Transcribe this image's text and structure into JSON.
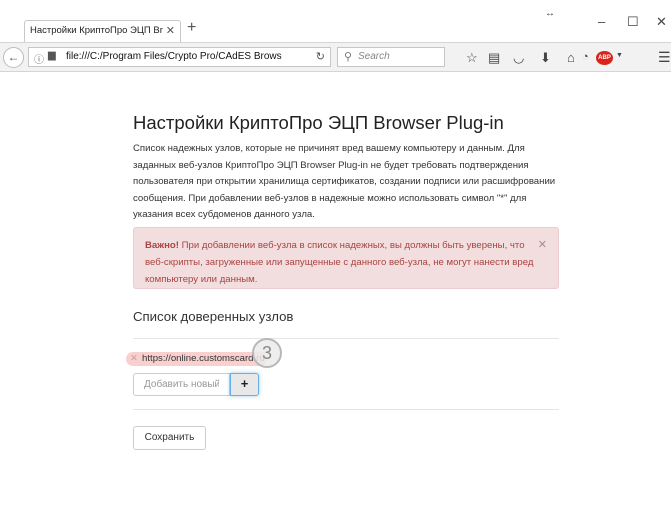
{
  "browser": {
    "tab_title": "Настройки КриптоПро ЭЦП Br",
    "url": "file:///C:/Program Files/Crypto Pro/CAdES Brows",
    "search_placeholder": "Search",
    "icons": [
      "back-arrow-icon",
      "info-icon",
      "page-icon",
      "reload-icon",
      "search-icon",
      "star-icon",
      "reading-list-icon",
      "pocket-icon",
      "download-icon",
      "home-icon",
      "shield-icon",
      "adblock-icon",
      "menu-icon"
    ]
  },
  "page": {
    "title": "Настройки КриптоПро ЭЦП Browser Plug-in",
    "intro": "Список надежных узлов, которые не причинят вред вашему компьютеру и данным. Для заданных веб-узлов КриптоПро ЭЦП Browser Plug-in не будет требовать подтверждения пользователя при открытии хранилища сертификатов, создании подписи или расшифровании сообщения. При добавлении веб-узлов в надежные можно использовать символ \"*\" для указания всех субдоменов данного узла.",
    "alert": {
      "strong": "Важно!",
      "text": " При добавлении веб-узла в список надежных, вы должны быть уверены, что веб-скрипты, загруженные или запущенные с данного веб-узла, не могут нанести вред компьютеру или данным."
    },
    "trusted_header": "Список доверенных узлов",
    "trusted_hosts": [
      "https://online.customscard.ru"
    ],
    "step_number": "3",
    "add_placeholder": "Добавить новый",
    "add_button": "+",
    "save_button": "Сохранить"
  },
  "colors": {
    "alert_bg": "#f2dede",
    "alert_text": "#a94442",
    "focus": "#66afe9"
  }
}
